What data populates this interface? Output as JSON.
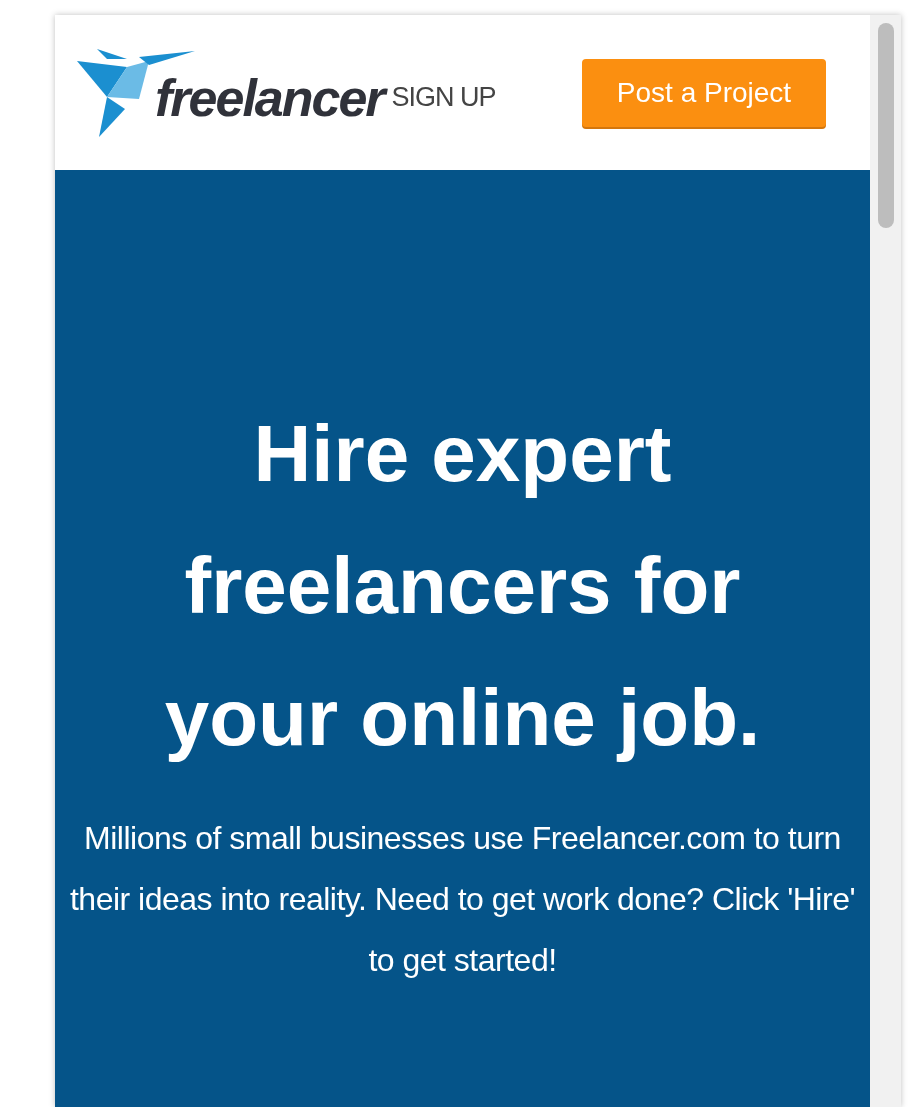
{
  "header": {
    "logo_text": "freelancer",
    "signup_link": "SIGN UP",
    "post_button": "Post a Project"
  },
  "hero": {
    "headline": "Hire expert freelancers for your online job.",
    "description": "Millions of small businesses use Freelancer.com to turn their ideas into reality. Need to get work done? Click 'Hire' to get started!"
  }
}
